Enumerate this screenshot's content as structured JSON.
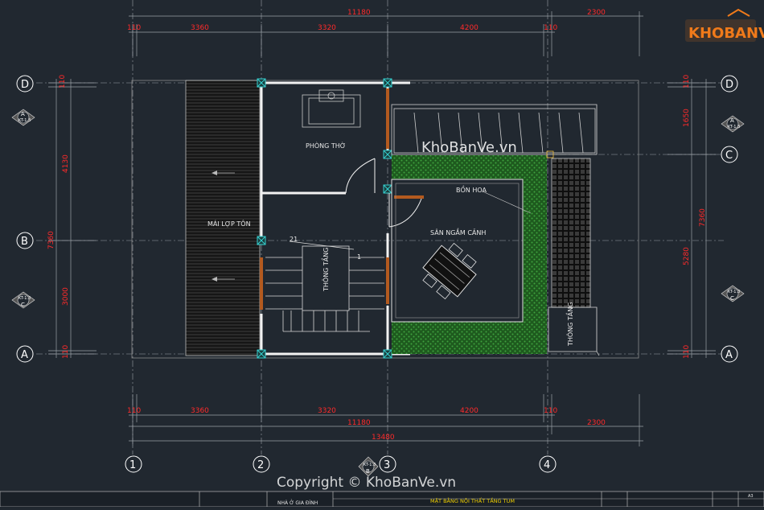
{
  "logo": {
    "text": "KHOBANVE"
  },
  "watermark": {
    "center": "KhoBanVe.vn",
    "copyright": "Copyright © KhoBanVe.vn"
  },
  "rooms": {
    "phong_tho": "PHÒNG THỜ",
    "mai_lop_ton": "MÁI LỢP TÔN",
    "thong_tang_stair": "THÔNG TẦNG",
    "thong_tang_right": "THÔNG TẦNG",
    "bon_hoa": "BỒN HOA",
    "san_ngam_canh": "SÂN NGẮM CẢNH",
    "stair_num_21": "21",
    "stair_num_1": "1"
  },
  "dimensions": {
    "top_total": "11180",
    "top_right": "2300",
    "top_segments": [
      "110",
      "3360",
      "3320",
      "4200",
      "110"
    ],
    "bottom_segments": [
      "110",
      "3360",
      "3320",
      "4200",
      "110"
    ],
    "bottom_total": "11180",
    "bottom_right": "2300",
    "bottom_overall": "13480",
    "left_segments": [
      "110",
      "4130",
      "7360",
      "3000",
      "110"
    ],
    "right_segments": [
      "110",
      "1650",
      "7360",
      "5280",
      "110"
    ]
  },
  "grid_bubbles": {
    "columns": [
      "1",
      "2",
      "3",
      "4"
    ],
    "rows_left": [
      "D",
      "B",
      "A"
    ],
    "rows_right": [
      "D",
      "C",
      "A"
    ]
  },
  "section_markers": {
    "left_top": {
      "letter": "A",
      "code": "KT-1.3"
    },
    "left_bottom": {
      "letter": "C",
      "code": "KT-1.3"
    },
    "right_top": {
      "letter": "A",
      "code": "KT-1.3"
    },
    "right_bottom": {
      "letter": "C",
      "code": "KT-1.3"
    },
    "bottom": {
      "letter": "B",
      "code": "KT-1.3"
    }
  },
  "title_block": {
    "title": "MẶT BẰNG NỘI THẤT TẦNG TUM",
    "project": "NHÀ Ở GIA ĐÌNH",
    "sheet": "A3"
  },
  "colors": {
    "background": "#212830",
    "dimension": "#ff2a2a",
    "green": "#1e5a1e",
    "logo": "#f07a1a"
  }
}
